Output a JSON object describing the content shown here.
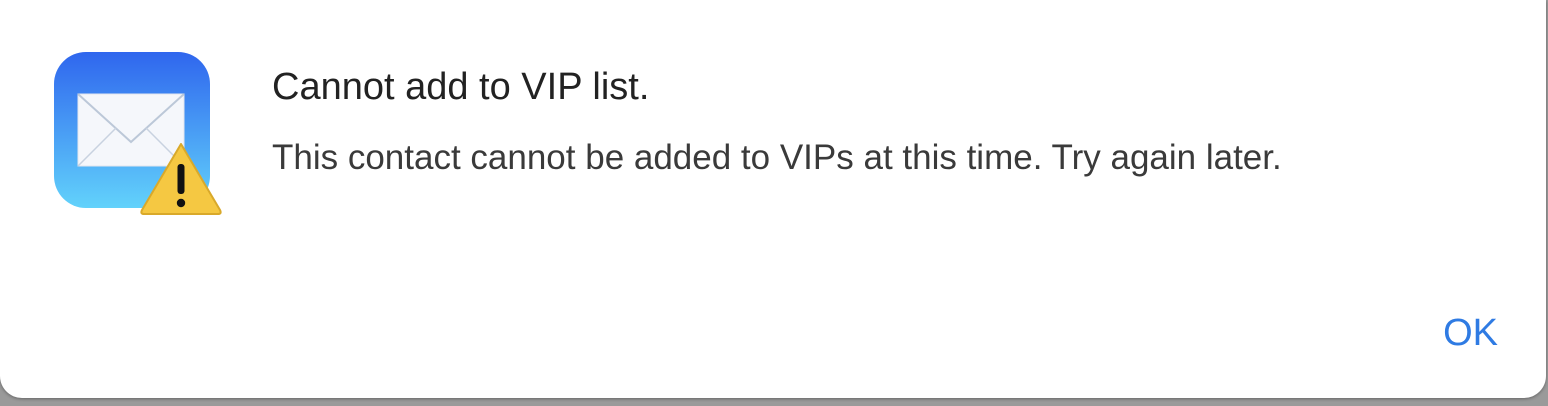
{
  "dialog": {
    "title": "Cannot add to VIP list.",
    "message": "This contact cannot be added to VIPs at this time. Try again later.",
    "ok_label": "OK",
    "icon": "mail-app-icon",
    "badge_icon": "warning-triangle-icon"
  },
  "colors": {
    "accent": "#2f7be3",
    "icon_gradient_top": "#2f6ff0",
    "icon_gradient_bottom": "#5fd0fb",
    "warning_yellow": "#f5c842"
  }
}
